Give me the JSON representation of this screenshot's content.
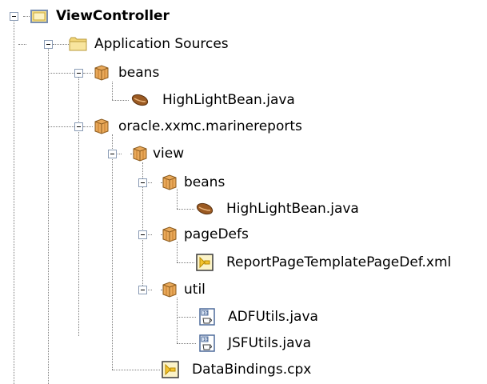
{
  "tree": {
    "root": {
      "label": "ViewController",
      "icon": "project-folder-icon"
    },
    "application_sources": {
      "label": "Application Sources",
      "icon": "folder-icon"
    },
    "beans_top": {
      "label": "beans",
      "icon": "package-icon"
    },
    "beans_top_file": {
      "label": "HighLightBean.java",
      "icon": "bean-icon"
    },
    "marinereports": {
      "label": "oracle.xxmc.marinereports",
      "icon": "package-icon"
    },
    "view": {
      "label": "view",
      "icon": "package-icon"
    },
    "view_beans": {
      "label": "beans",
      "icon": "package-icon"
    },
    "view_beans_file": {
      "label": "HighLightBean.java",
      "icon": "bean-icon"
    },
    "pagedefs": {
      "label": "pageDefs",
      "icon": "package-icon"
    },
    "pagedefs_file": {
      "label": "ReportPageTemplatePageDef.xml",
      "icon": "xml-file-icon"
    },
    "util": {
      "label": "util",
      "icon": "package-icon"
    },
    "util_file_1": {
      "label": "ADFUtils.java",
      "icon": "java-class-icon"
    },
    "util_file_2": {
      "label": "JSFUtils.java",
      "icon": "java-class-icon"
    },
    "databindings": {
      "label": "DataBindings.cpx",
      "icon": "xml-file-icon"
    }
  }
}
